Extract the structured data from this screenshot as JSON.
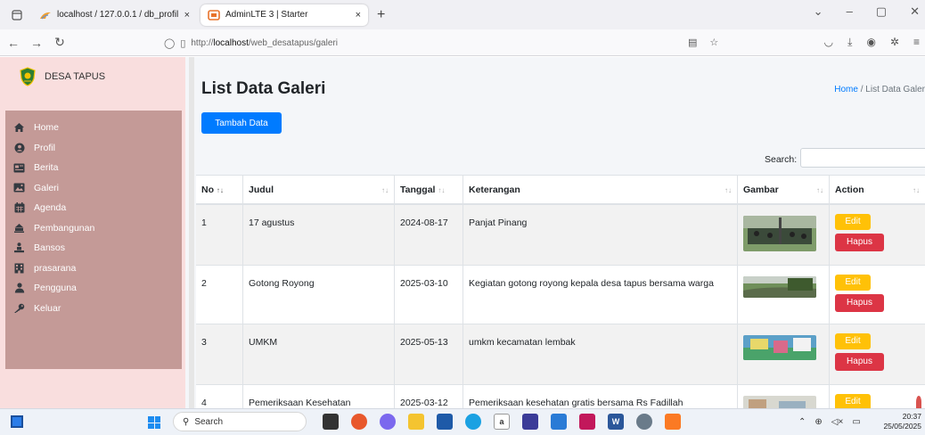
{
  "browser": {
    "tabs": [
      {
        "title": "localhost / 127.0.0.1 / db_profil",
        "close": "×"
      },
      {
        "title": "AdminLTE 3 | Starter",
        "close": "×"
      }
    ],
    "new_tab": "+",
    "url_prefix": "http://",
    "url_host": "localhost",
    "url_path": "/web_desatapus/galeri"
  },
  "sidebar": {
    "brand": "DESA TAPUS",
    "items": [
      {
        "label": "Home",
        "icon": "home-icon"
      },
      {
        "label": "Profil",
        "icon": "user-circle-icon"
      },
      {
        "label": "Berita",
        "icon": "newspaper-icon"
      },
      {
        "label": "Galeri",
        "icon": "image-icon"
      },
      {
        "label": "Agenda",
        "icon": "calendar-icon"
      },
      {
        "label": "Pembangunan",
        "icon": "building-icon"
      },
      {
        "label": "Bansos",
        "icon": "people-carry-icon"
      },
      {
        "label": "prasarana",
        "icon": "building-icon"
      },
      {
        "label": "Pengguna",
        "icon": "user-icon"
      },
      {
        "label": "Keluar",
        "icon": "key-icon"
      }
    ]
  },
  "header": {
    "title": "List Data Galeri",
    "breadcrumb_home": "Home",
    "breadcrumb_sep": "/",
    "breadcrumb_current": "List Data Galer"
  },
  "actions": {
    "add_label": "Tambah Data"
  },
  "search": {
    "label": "Search:",
    "value": ""
  },
  "table": {
    "columns": [
      "No",
      "Judul",
      "Tanggal",
      "Keterangan",
      "Gambar",
      "Action"
    ],
    "rows": [
      {
        "no": "1",
        "judul": "17 agustus",
        "tanggal": "2024-08-17",
        "keterangan": "Panjat Pinang"
      },
      {
        "no": "2",
        "judul": "Gotong Royong",
        "tanggal": "2025-03-10",
        "keterangan": "Kegiatan gotong royong kepala desa tapus bersama warga"
      },
      {
        "no": "3",
        "judul": "UMKM",
        "tanggal": "2025-05-13",
        "keterangan": "umkm kecamatan lembak"
      },
      {
        "no": "4",
        "judul": "Pemeriksaan Kesehatan",
        "tanggal": "2025-03-12",
        "keterangan": "Pemeriksaan kesehatan gratis bersama Rs Fadillah"
      }
    ],
    "edit_label": "Edit",
    "delete_label": "Hapus"
  },
  "taskbar": {
    "search_placeholder": "Search",
    "time": "20:37",
    "date": "25/05/2025"
  },
  "colors": {
    "sidebar_bg": "#f9dede",
    "menu_bg": "#c49a97",
    "primary": "#007bff",
    "warning": "#ffc107",
    "danger": "#dc3545"
  }
}
